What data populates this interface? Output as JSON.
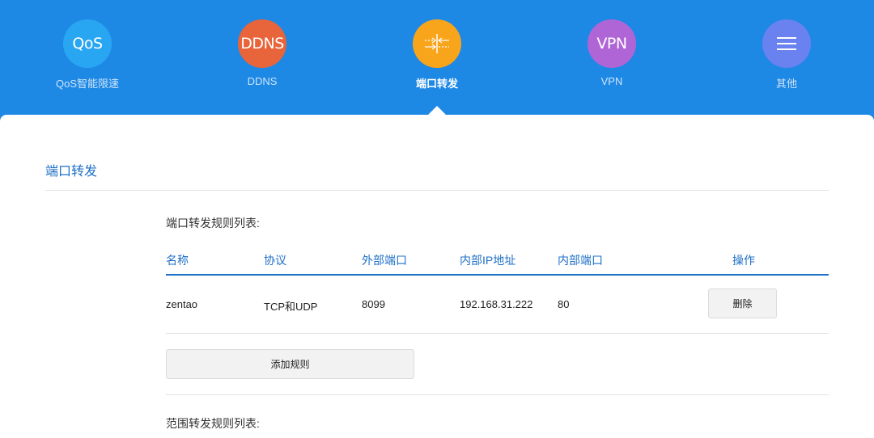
{
  "nav": {
    "items": [
      {
        "badge": "QoS",
        "label": "QoS智能限速",
        "color": "#29a6f2",
        "icon": "qos-icon"
      },
      {
        "badge": "DDNS",
        "label": "DDNS",
        "color": "#e8643a",
        "icon": "ddns-icon"
      },
      {
        "badge": "",
        "label": "端口转发",
        "color": "#f9a51b",
        "icon": "port-forward-icon",
        "active": true
      },
      {
        "badge": "VPN",
        "label": "VPN",
        "color": "#b065d6",
        "icon": "vpn-icon"
      },
      {
        "badge": "",
        "label": "其他",
        "color": "#6a82f0",
        "icon": "menu-icon"
      }
    ]
  },
  "section": {
    "title": "端口转发"
  },
  "port_rules": {
    "title": "端口转发规则列表:",
    "columns": [
      "名称",
      "协议",
      "外部端口",
      "内部IP地址",
      "内部端口",
      "操作"
    ],
    "rows": [
      {
        "name": "zentao",
        "protocol": "TCP和UDP",
        "ext_port": "8099",
        "ip": "192.168.31.222",
        "int_port": "80",
        "action": "删除"
      }
    ],
    "add_label": "添加规则"
  },
  "range_rules": {
    "title": "范围转发规则列表:"
  },
  "colors": {
    "header_bg": "#1e88e5",
    "accent": "#1e6fc6"
  }
}
